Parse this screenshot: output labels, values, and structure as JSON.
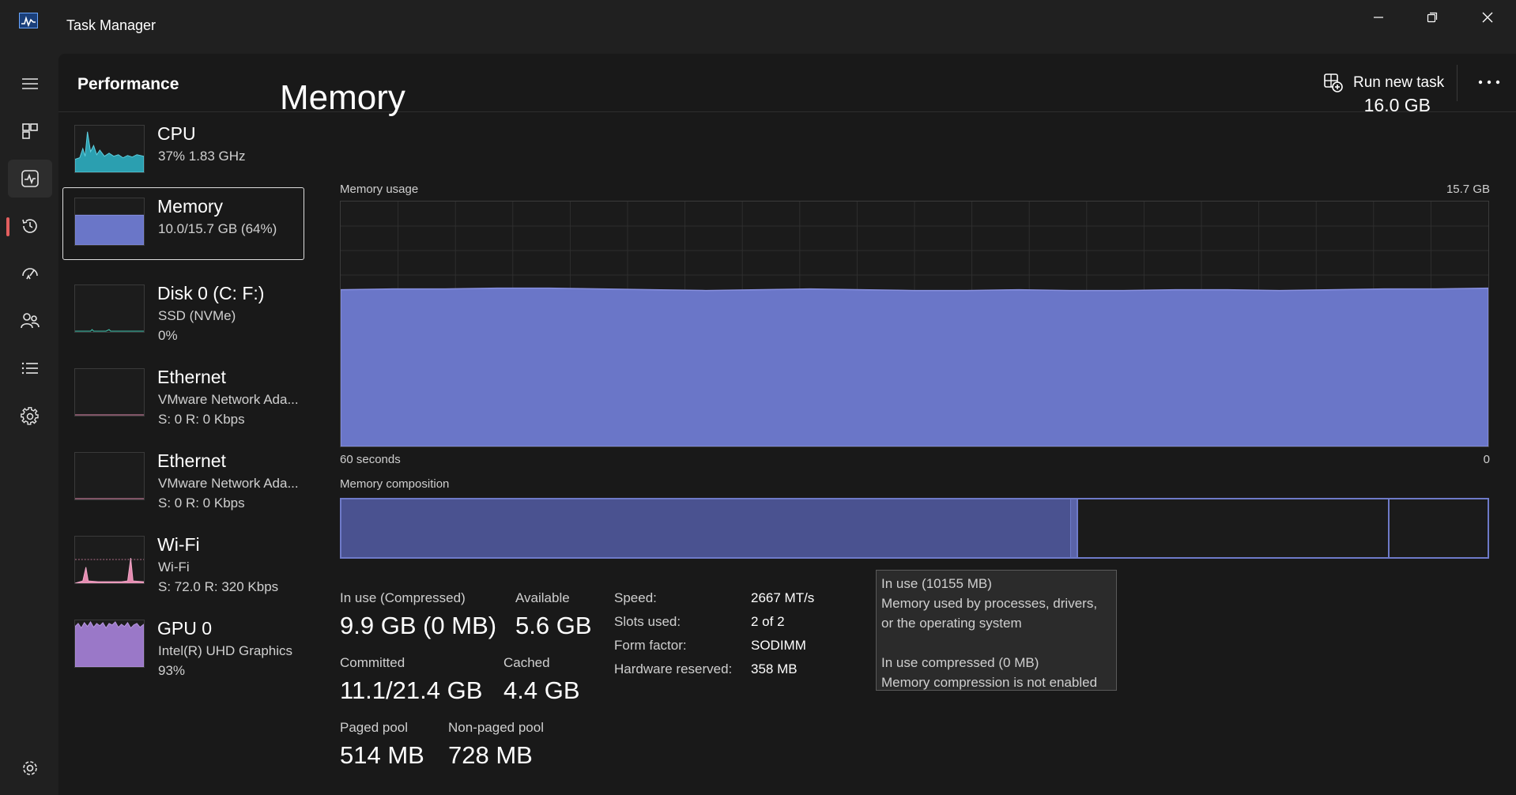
{
  "window": {
    "title": "Task Manager"
  },
  "header": {
    "title": "Performance",
    "run_task_label": "Run new task"
  },
  "nav": [
    {
      "name": "menu-icon",
      "active": false
    },
    {
      "name": "processes-icon",
      "active": false
    },
    {
      "name": "performance-icon",
      "active": true
    },
    {
      "name": "app-history-icon",
      "active": false
    },
    {
      "name": "startup-apps-icon",
      "active": false
    },
    {
      "name": "users-icon",
      "active": false
    },
    {
      "name": "details-icon",
      "active": false
    },
    {
      "name": "services-icon",
      "active": false
    },
    {
      "name": "settings-icon",
      "active": false
    }
  ],
  "devices": [
    {
      "name": "CPU",
      "sub1": "37%  1.83 GHz",
      "sub2": "",
      "color": "#3cb4c8"
    },
    {
      "name": "Memory",
      "sub1": "10.0/15.7 GB (64%)",
      "sub2": "",
      "color": "#6e7ac8",
      "selected": true
    },
    {
      "name": "Disk 0 (C: F:)",
      "sub1": "SSD (NVMe)",
      "sub2": "0%",
      "color": "#3cb4a0"
    },
    {
      "name": "Ethernet",
      "sub1": "VMware Network Ada...",
      "sub2": "S: 0  R: 0 Kbps",
      "color": "#e58bb0"
    },
    {
      "name": "Ethernet",
      "sub1": "VMware Network Ada...",
      "sub2": "S: 0  R: 0 Kbps",
      "color": "#e58bb0"
    },
    {
      "name": "Wi-Fi",
      "sub1": "Wi-Fi",
      "sub2": "S: 72.0  R: 320 Kbps",
      "color": "#e58bb0"
    },
    {
      "name": "GPU 0",
      "sub1": "Intel(R) UHD Graphics",
      "sub2": "93%",
      "color": "#9a78c8"
    }
  ],
  "memory": {
    "title": "Memory",
    "total": "16.0 GB",
    "usage_label": "Memory usage",
    "usage_max": "15.7 GB",
    "time_left": "60 seconds",
    "time_right": "0",
    "composition_label": "Memory composition",
    "usage_level_percent": 64,
    "stats": {
      "in_use_label": "In use (Compressed)",
      "in_use_value": "9.9 GB (0 MB)",
      "available_label": "Available",
      "available_value": "5.6 GB",
      "committed_label": "Committed",
      "committed_value": "11.1/21.4 GB",
      "cached_label": "Cached",
      "cached_value": "4.4 GB",
      "paged_label": "Paged pool",
      "paged_value": "514 MB",
      "nonpaged_label": "Non-paged pool",
      "nonpaged_value": "728 MB"
    },
    "specs": [
      {
        "label": "Speed:",
        "value": "2667 MT/s"
      },
      {
        "label": "Slots used:",
        "value": "2 of 2"
      },
      {
        "label": "Form factor:",
        "value": "SODIMM"
      },
      {
        "label": "Hardware reserved:",
        "value": "358 MB"
      }
    ],
    "tooltip": {
      "line1": "In use (10155 MB)",
      "line2": "Memory used by processes, drivers,",
      "line3": "or the operating system",
      "line4": "In use compressed (0 MB)",
      "line5": "Memory compression is not enabled"
    }
  },
  "colors": {
    "memory_fill": "#6a76c8",
    "memory_line": "#8890e0",
    "accent": "#e35e5e"
  }
}
